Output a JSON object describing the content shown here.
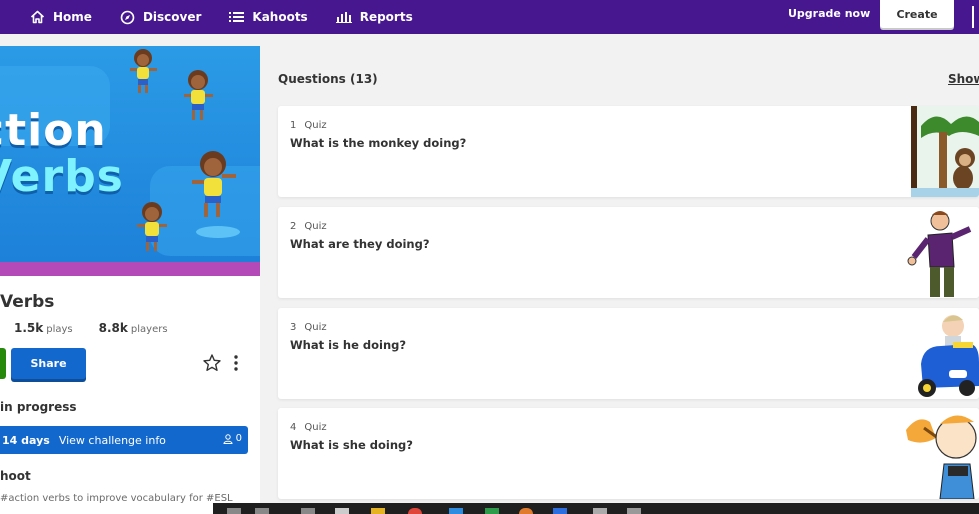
{
  "nav": {
    "home": "Home",
    "discover": "Discover",
    "kahoots": "Kahoots",
    "reports": "Reports",
    "upgrade": "Upgrade now",
    "create": "Create"
  },
  "kahoot": {
    "cover_line1": "ction",
    "cover_line2": "Verbs",
    "title": "Verbs",
    "plays_value": "1.5k",
    "plays_label": "plays",
    "players_value": "8.8k",
    "players_label": "players",
    "share_label": "Share",
    "in_progress_label": "in progress",
    "challenge_days": "14 days",
    "challenge_info": "View challenge info",
    "challenge_count": "0",
    "about_label": "hoot",
    "description": "#action verbs to improve vocabulary for #ESL"
  },
  "questions": {
    "header": "Questions (13)",
    "show_link": "Show",
    "items": [
      {
        "number": "1",
        "type": "Quiz",
        "text": "What is the monkey doing?"
      },
      {
        "number": "2",
        "type": "Quiz",
        "text": "What are they doing?"
      },
      {
        "number": "3",
        "type": "Quiz",
        "text": "What is he doing?"
      },
      {
        "number": "4",
        "type": "Quiz",
        "text": "What is she doing?"
      }
    ]
  },
  "colors": {
    "topbar": "#46178f",
    "share": "#1368ce",
    "play_green": "#26890c",
    "background": "#f2f2f2"
  }
}
